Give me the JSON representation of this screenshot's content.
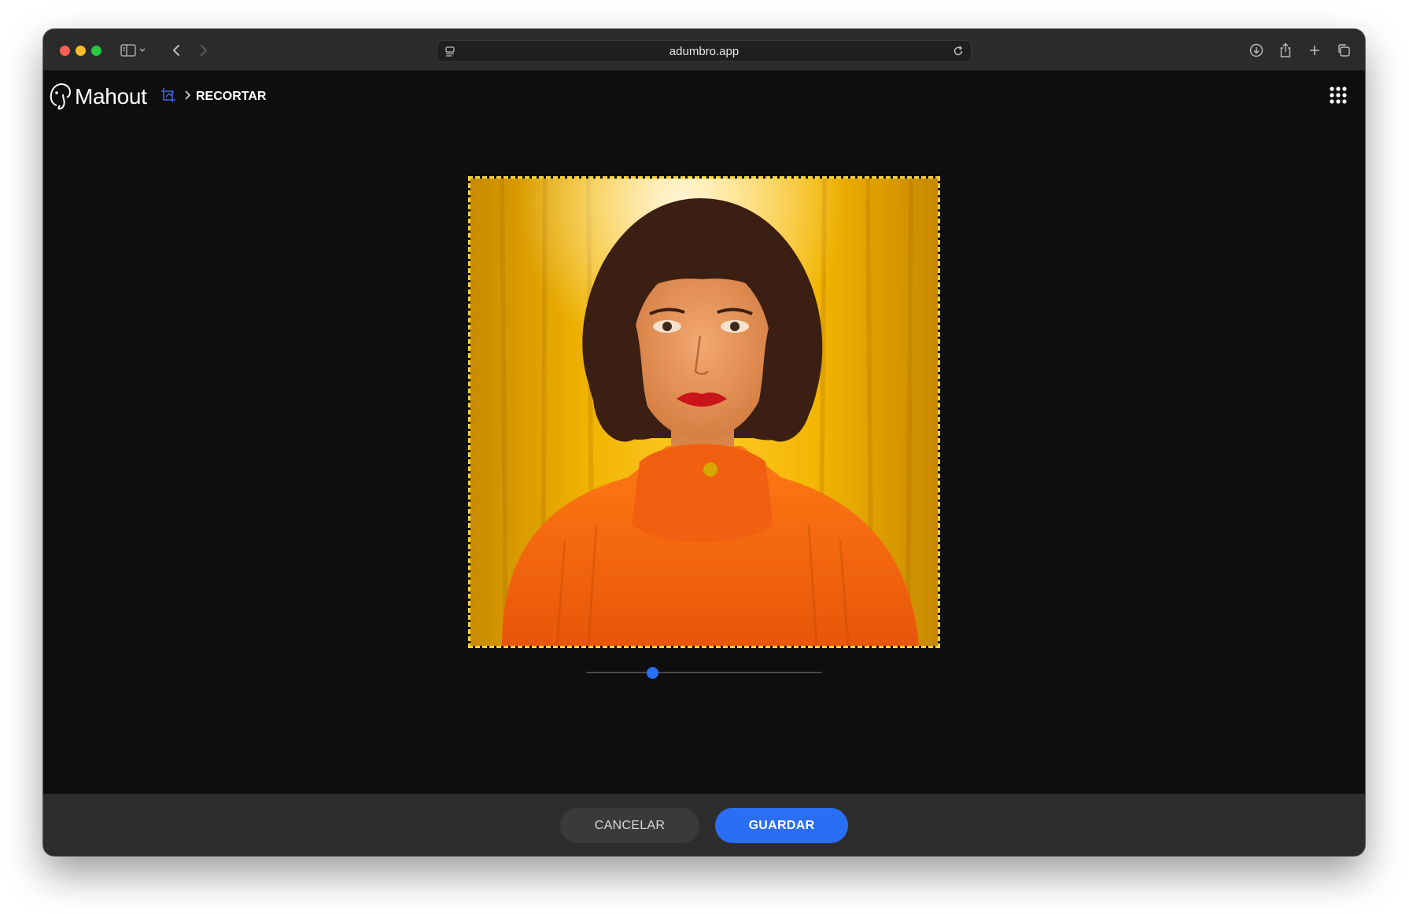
{
  "browser": {
    "url": "adumbro.app",
    "icons": [
      "sidebar-toggle-icon",
      "chevron-down-icon",
      "back-icon",
      "forward-icon",
      "site-settings-icon",
      "reload-icon",
      "download-icon",
      "share-icon",
      "new-tab-icon",
      "tab-overview-icon"
    ]
  },
  "app": {
    "brand": "Mahout",
    "breadcrumb": {
      "section_icon": "crop-icon",
      "separator_icon": "chevron-right-icon",
      "current": "RECORTAR"
    },
    "menu_icon": "apps-grid-icon"
  },
  "editor": {
    "image_description_icon": "portrait-photo",
    "zoom_level": 0.28
  },
  "actions": {
    "cancel_label": "CANCELAR",
    "save_label": "GUARDAR"
  },
  "colors": {
    "accent": "#2a6ef5",
    "crop_border": "#f4d23a",
    "background": "#0e0e0e"
  }
}
